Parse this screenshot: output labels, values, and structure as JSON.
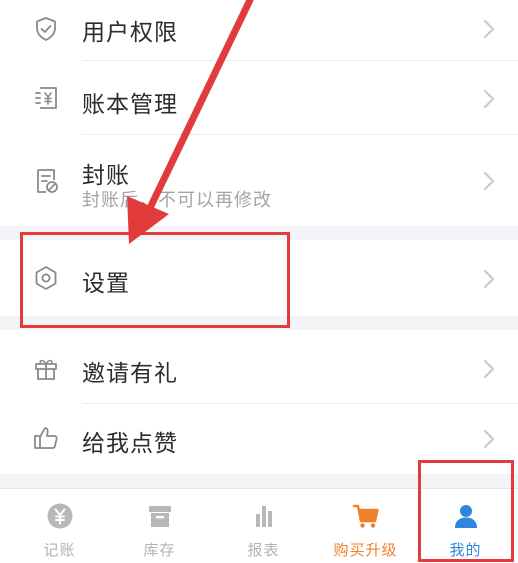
{
  "menu": {
    "user_permissions": {
      "label": "用户权限",
      "icon": "shield-check-icon"
    },
    "ledger_management": {
      "label": "账本管理",
      "icon": "ledger-yuan-icon"
    },
    "close_accounts": {
      "label": "封账",
      "sub": "封账后，不可以再修改",
      "icon": "document-lock-icon"
    },
    "settings": {
      "label": "设置",
      "icon": "hexagon-settings-icon"
    },
    "invite": {
      "label": "邀请有礼",
      "icon": "gift-icon"
    },
    "like": {
      "label": "给我点赞",
      "icon": "thumbs-up-icon"
    }
  },
  "tabs": [
    {
      "label": "记账",
      "icon": "yuan-coin-icon"
    },
    {
      "label": "库存",
      "icon": "archive-box-icon"
    },
    {
      "label": "报表",
      "icon": "bar-chart-icon"
    },
    {
      "label": "购买升级",
      "icon": "shopping-cart-icon"
    },
    {
      "label": "我的",
      "icon": "user-icon"
    }
  ],
  "colors": {
    "annotation": "#e23b3b",
    "tab_active": "#2f86dd",
    "tab_upgrade": "#f0812c",
    "tab_inactive": "#b3b3b3"
  }
}
